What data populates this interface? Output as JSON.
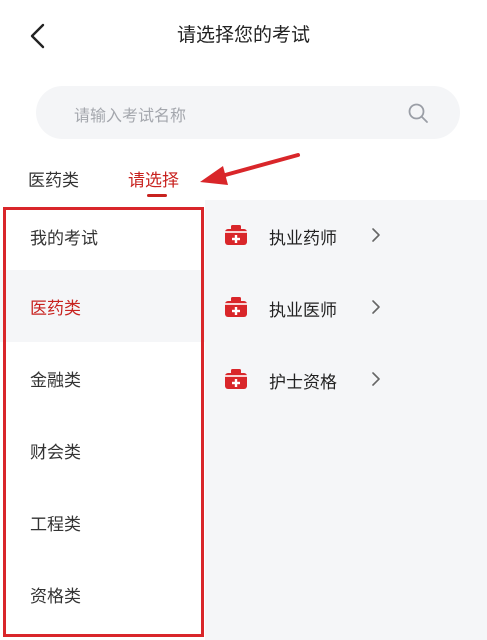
{
  "header": {
    "title": "请选择您的考试",
    "back_icon": "chevron-left-icon"
  },
  "search": {
    "placeholder": "请输入考试名称",
    "icon": "search-icon"
  },
  "tabs": [
    {
      "label": "医药类",
      "active": false
    },
    {
      "label": "请选择",
      "active": true
    }
  ],
  "sidebar": {
    "items": [
      {
        "label": "我的考试",
        "active": false
      },
      {
        "label": "医药类",
        "active": true
      },
      {
        "label": "金融类",
        "active": false
      },
      {
        "label": "财会类",
        "active": false
      },
      {
        "label": "工程类",
        "active": false
      },
      {
        "label": "资格类",
        "active": false
      }
    ]
  },
  "exams": {
    "items": [
      {
        "label": "执业药师",
        "icon": "medical-kit-icon"
      },
      {
        "label": "执业医师",
        "icon": "medical-kit-icon"
      },
      {
        "label": "护士资格",
        "icon": "medical-kit-icon"
      }
    ]
  },
  "colors": {
    "accent": "#c8221f",
    "annotation": "#d9262a",
    "panel_bg": "#f5f6f8"
  }
}
